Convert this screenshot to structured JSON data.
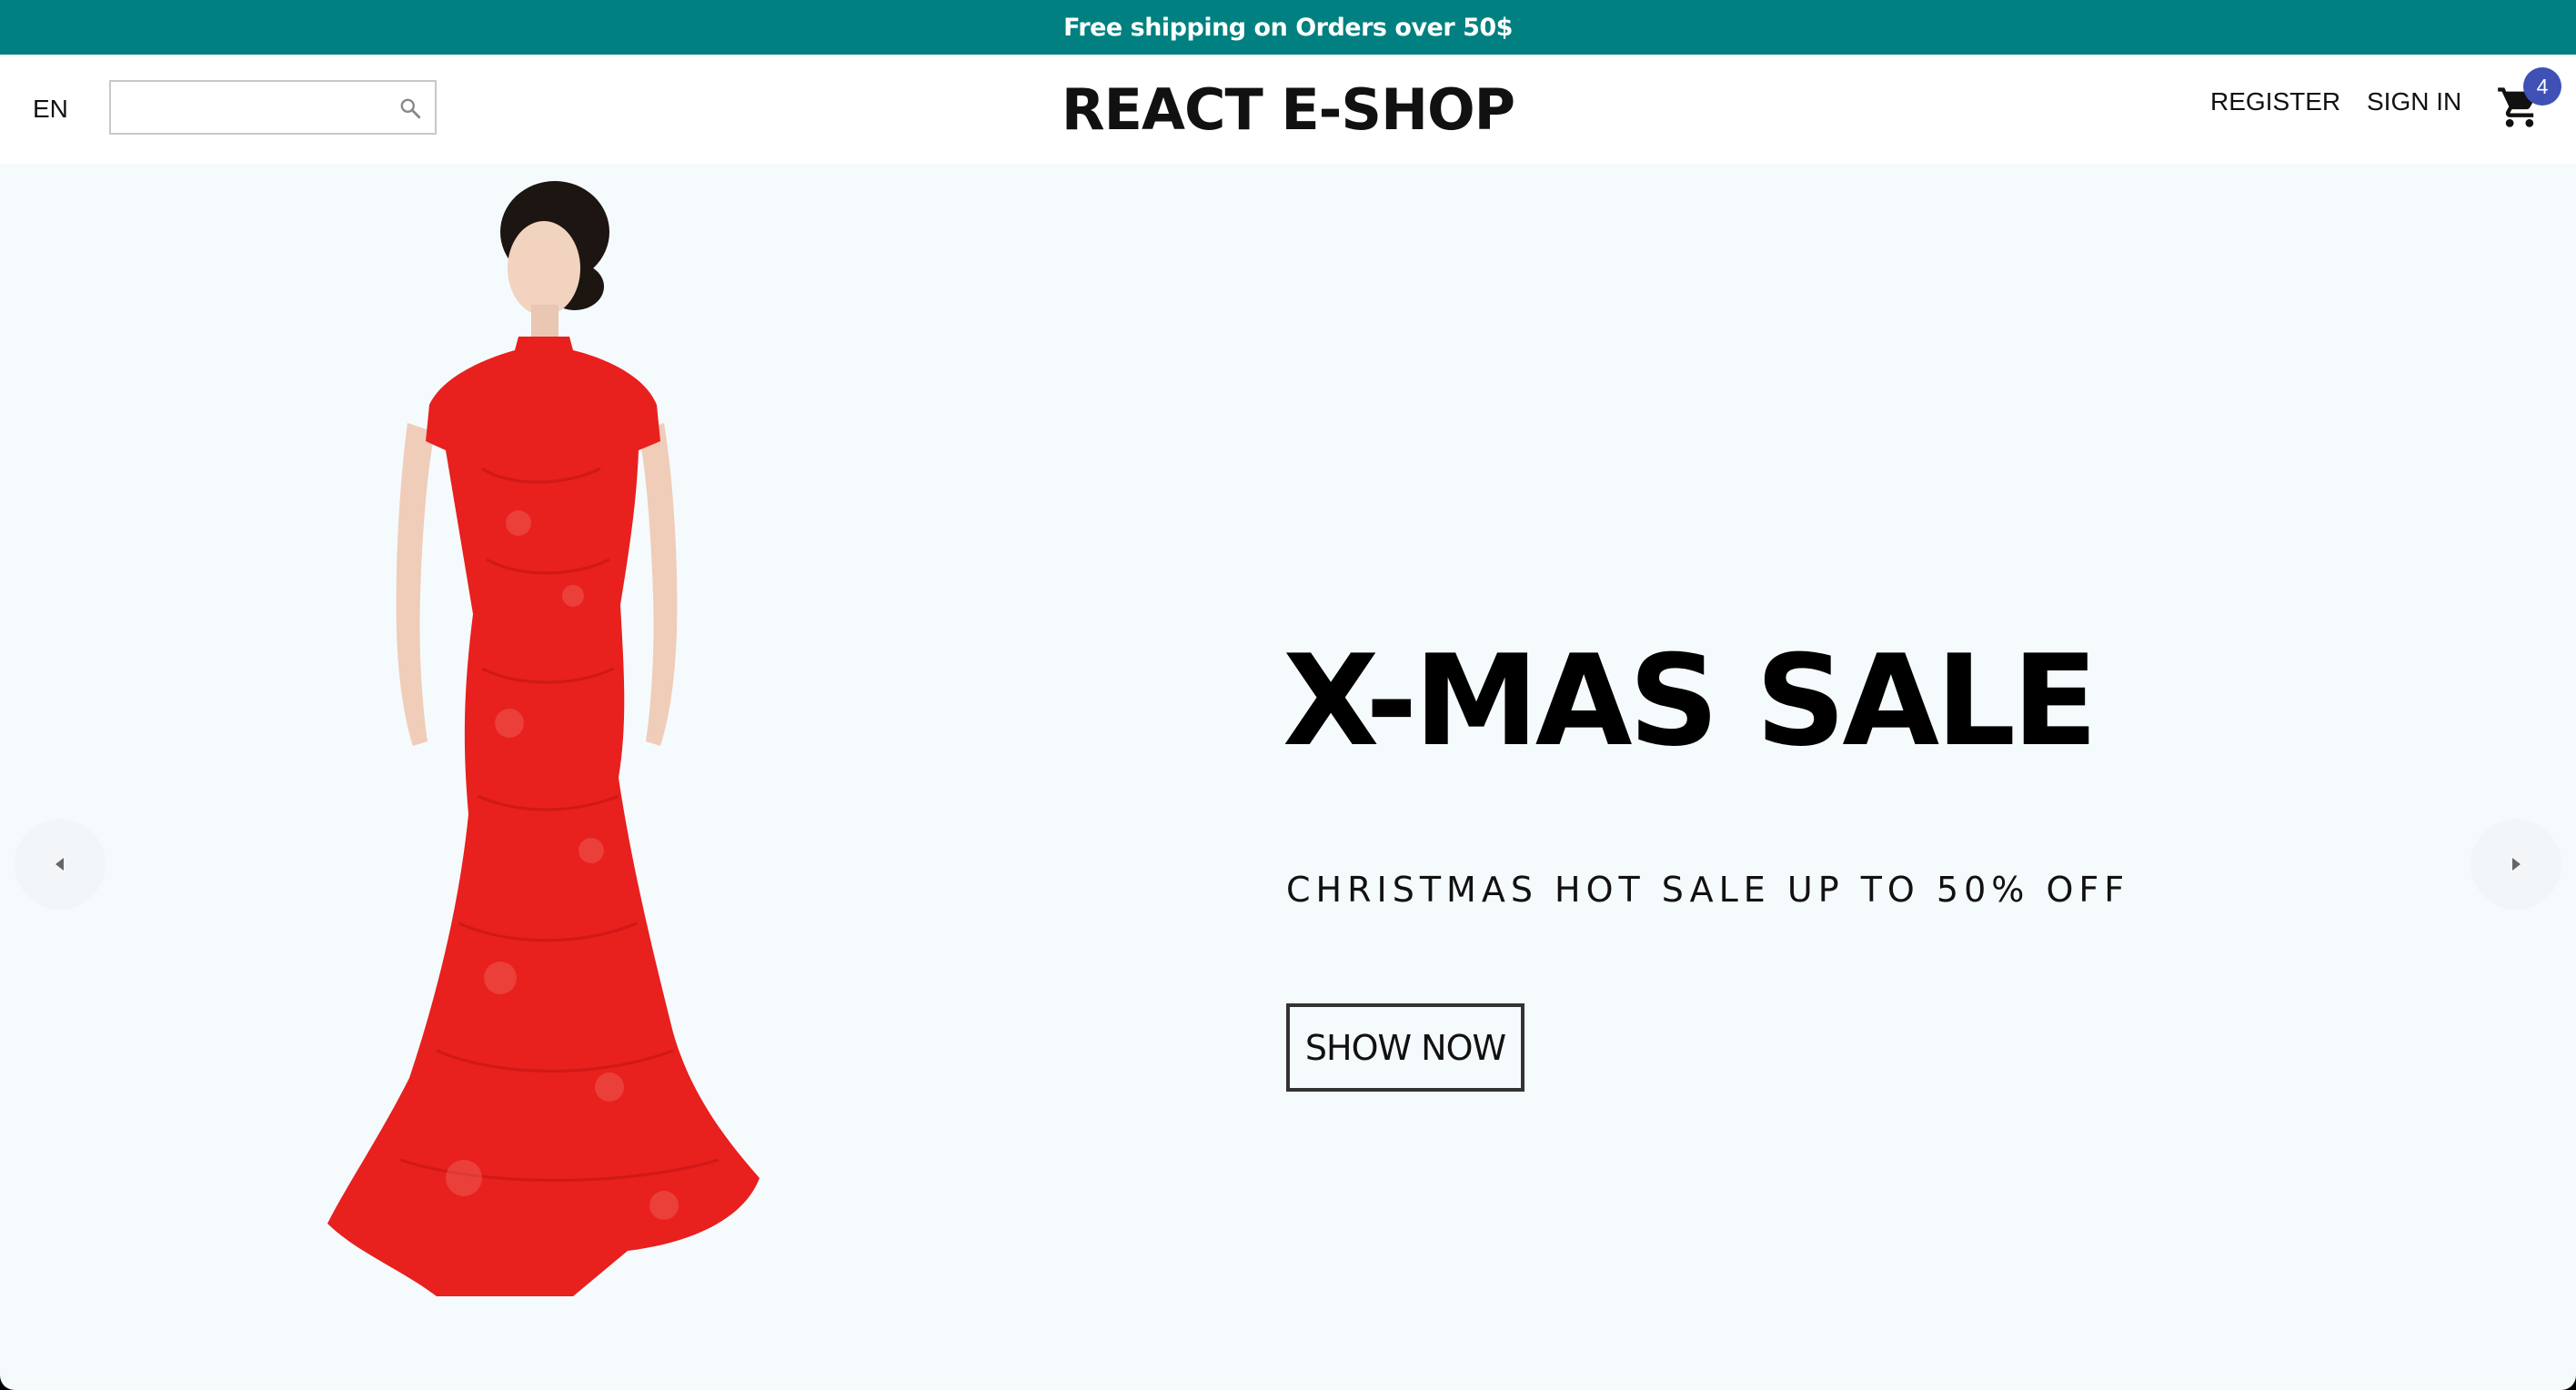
{
  "announcement": {
    "text": "Free shipping on Orders over 50$"
  },
  "navbar": {
    "language": "EN",
    "search": {
      "value": "",
      "placeholder": ""
    },
    "logo": "REACT E-SHOP",
    "register_label": "REGISTER",
    "signin_label": "SIGN IN",
    "cart": {
      "count": "4",
      "icon": "shopping-cart-icon"
    }
  },
  "slider": {
    "title": "X-MAS SALE",
    "description": "CHRISTMAS HOT SALE UP TO 50% OFF",
    "button_label": "SHOW NOW",
    "image_icon": "red-dress-model-image",
    "left_arrow_icon": "arrow-left-icon",
    "right_arrow_icon": "arrow-right-icon"
  },
  "colors": {
    "announcement_bg": "#008080",
    "slide_bg": "#f5fafd",
    "badge_bg": "#3f51b5",
    "dress_red": "#e8201e"
  }
}
